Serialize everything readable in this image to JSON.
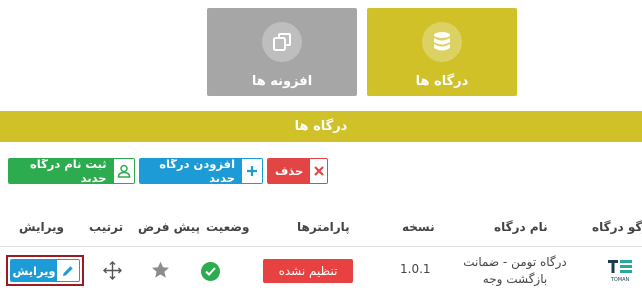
{
  "tiles": {
    "gateways_label": "درگاه ها",
    "addons_label": "افزونه ها"
  },
  "section": {
    "title": "درگاه ها"
  },
  "actions": {
    "delete_label": "حذف",
    "add_label": "افزودن درگاه جدید",
    "register_label": "ثبت نام درگاه جدید"
  },
  "table": {
    "headers": {
      "logo": "وگو درگاه",
      "name": "نام درگاه",
      "version": "نسخه",
      "params": "پارامترها",
      "status": "وضعیت",
      "default": "پیش فرض",
      "order": "ترتیب",
      "edit": "ویرایش"
    },
    "rows": [
      {
        "logo_text": "TOMAN",
        "name_line1": "درگاه تومن - ضمانت",
        "name_line2": "بازگشت وجه",
        "version": "1.0.1",
        "params_badge": "تنظیم نشده",
        "edit_label": "ویرایش"
      }
    ]
  },
  "colors": {
    "accent": "#cfc127",
    "addon_tile": "#a6a6a6",
    "danger": "#e34545",
    "primary": "#1d9bd6",
    "success": "#2dab4f",
    "highlight": "#9b1c20"
  },
  "icons": {
    "gateways_tile": "database-icon",
    "addons_tile": "copy-icon",
    "delete": "close-icon",
    "add": "plus-icon",
    "register": "user-icon",
    "status": "check-circle-icon",
    "default": "star-icon",
    "order": "move-arrows-icon",
    "edit": "pencil-icon"
  }
}
